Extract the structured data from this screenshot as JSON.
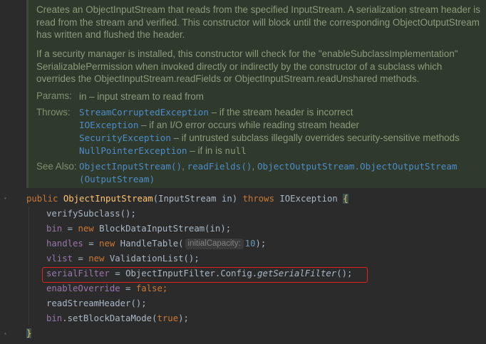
{
  "doc": {
    "para1": "Creates an ObjectInputStream that reads from the specified InputStream. A serialization stream header is read from the stream and verified. This constructor will block until the corresponding ObjectOutputStream has written and flushed the header.",
    "para2": "If a security manager is installed, this constructor will check for the \"enableSubclassImplementation\" SerializablePermission when invoked directly or indirectly by the constructor of a subclass which overrides the ObjectInputStream.readFields or ObjectInputStream.readUnshared methods.",
    "params_label": "Params:",
    "params_text": "in – input stream to read from",
    "throws_label": "Throws:",
    "throws": [
      {
        "exception": "StreamCorruptedException",
        "text": " – if the stream header is incorrect"
      },
      {
        "exception": "IOException",
        "text": " – if an I/O error occurs while reading stream header"
      },
      {
        "exception": "SecurityException",
        "text": " – if untrusted subclass illegally overrides security-sensitive methods"
      },
      {
        "exception": "NullPointerException",
        "text": " – if in is ",
        "code": "null"
      }
    ],
    "see_also_label": "See Also:",
    "see_also": {
      "link1": "ObjectInputStream()",
      "sep1": ", ",
      "link2": "readFields()",
      "sep2": ", ",
      "link3": "ObjectOutputStream.ObjectOutputStream",
      "link3_cont": "(OutputStream)"
    }
  },
  "code": {
    "signature": {
      "kw_public": "public ",
      "name": "ObjectInputStream",
      "params": "(InputStream in) ",
      "kw_throws": "throws ",
      "exception": "IOException ",
      "open_brace": "{"
    },
    "lines": {
      "l1": "verifySubclass();",
      "l2_field": "bin",
      "l2_eq": " = ",
      "l2_new": "new ",
      "l2_rest": "BlockDataInputStream(in);",
      "l3_field": "handles",
      "l3_eq": " = ",
      "l3_new": "new ",
      "l3_call": "HandleTable(",
      "l3_hint": "initialCapacity:",
      "l3_num": "10",
      "l3_end": ");",
      "l4_field": "vlist",
      "l4_eq": " = ",
      "l4_new": "new ",
      "l4_rest": "ValidationList();",
      "l5_field": "serialFilter",
      "l5_eq": " = ",
      "l5_mid": "ObjectInputFilter.Config.",
      "l5_method": "getSerialFilter",
      "l5_end": "();",
      "l6_field": "enableOverride",
      "l6_eq": " = ",
      "l6_kw": "false",
      "l6_end": ";",
      "l7": "readStreamHeader();",
      "l8_field": "bin",
      "l8_rest": ".setBlockDataMode(",
      "l8_kw": "true",
      "l8_end": ");"
    },
    "close_brace": "}"
  },
  "colors": {
    "background": "#2b2b2b",
    "doc_background": "#2f3a2c",
    "highlight_border": "#e0211d"
  }
}
